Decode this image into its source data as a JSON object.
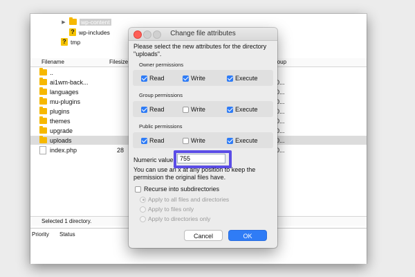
{
  "tree": [
    {
      "label": "wp-content",
      "type": "folder",
      "expanded": false,
      "selected": true
    },
    {
      "label": "wp-includes",
      "type": "unknown"
    },
    {
      "label": "tmp",
      "type": "unknown"
    }
  ],
  "filelist": {
    "headers": {
      "filename": "Filename",
      "filesize": "Filesize",
      "group": "roup"
    },
    "rows": [
      {
        "name": "..",
        "size": "",
        "right": "",
        "type": "folder"
      },
      {
        "name": "ai1wm-back...",
        "size": "",
        "right": "0...",
        "type": "folder"
      },
      {
        "name": "languages",
        "size": "",
        "right": "0...",
        "type": "folder"
      },
      {
        "name": "mu-plugins",
        "size": "",
        "right": "0...",
        "type": "folder"
      },
      {
        "name": "plugins",
        "size": "",
        "right": "0...",
        "type": "folder"
      },
      {
        "name": "themes",
        "size": "",
        "right": "0...",
        "type": "folder"
      },
      {
        "name": "upgrade",
        "size": "",
        "right": "0...",
        "type": "folder"
      },
      {
        "name": "uploads",
        "size": "",
        "right": "0...",
        "type": "folder",
        "selected": true
      },
      {
        "name": "index.php",
        "size": "28",
        "right": "0...",
        "type": "file"
      }
    ],
    "status": "Selected 1 directory."
  },
  "queue": {
    "priority": "Priority",
    "status": "Status"
  },
  "dialog": {
    "title": "Change file attributes",
    "intro": "Please select the new attributes for the directory \"uploads\".",
    "groups": [
      {
        "label": "Owner permissions",
        "read": true,
        "write": true,
        "execute": true
      },
      {
        "label": "Group permissions",
        "read": true,
        "write": false,
        "execute": true
      },
      {
        "label": "Public permissions",
        "read": true,
        "write": false,
        "execute": true
      }
    ],
    "labels": {
      "read": "Read",
      "write": "Write",
      "execute": "Execute"
    },
    "numeric_label": "Numeric value",
    "numeric_value": "755",
    "help": "You can use an x at any position to keep the permission the original files have.",
    "recurse_label": "Recurse into subdirectories",
    "radios": [
      {
        "label": "Apply to all files and directories",
        "selected": true
      },
      {
        "label": "Apply to files only",
        "selected": false
      },
      {
        "label": "Apply to directories only",
        "selected": false
      }
    ],
    "cancel": "Cancel",
    "ok": "OK"
  },
  "colors": {
    "accent": "#2f7cf6",
    "highlight": "#5b4de6",
    "folder": "#f6b800"
  }
}
